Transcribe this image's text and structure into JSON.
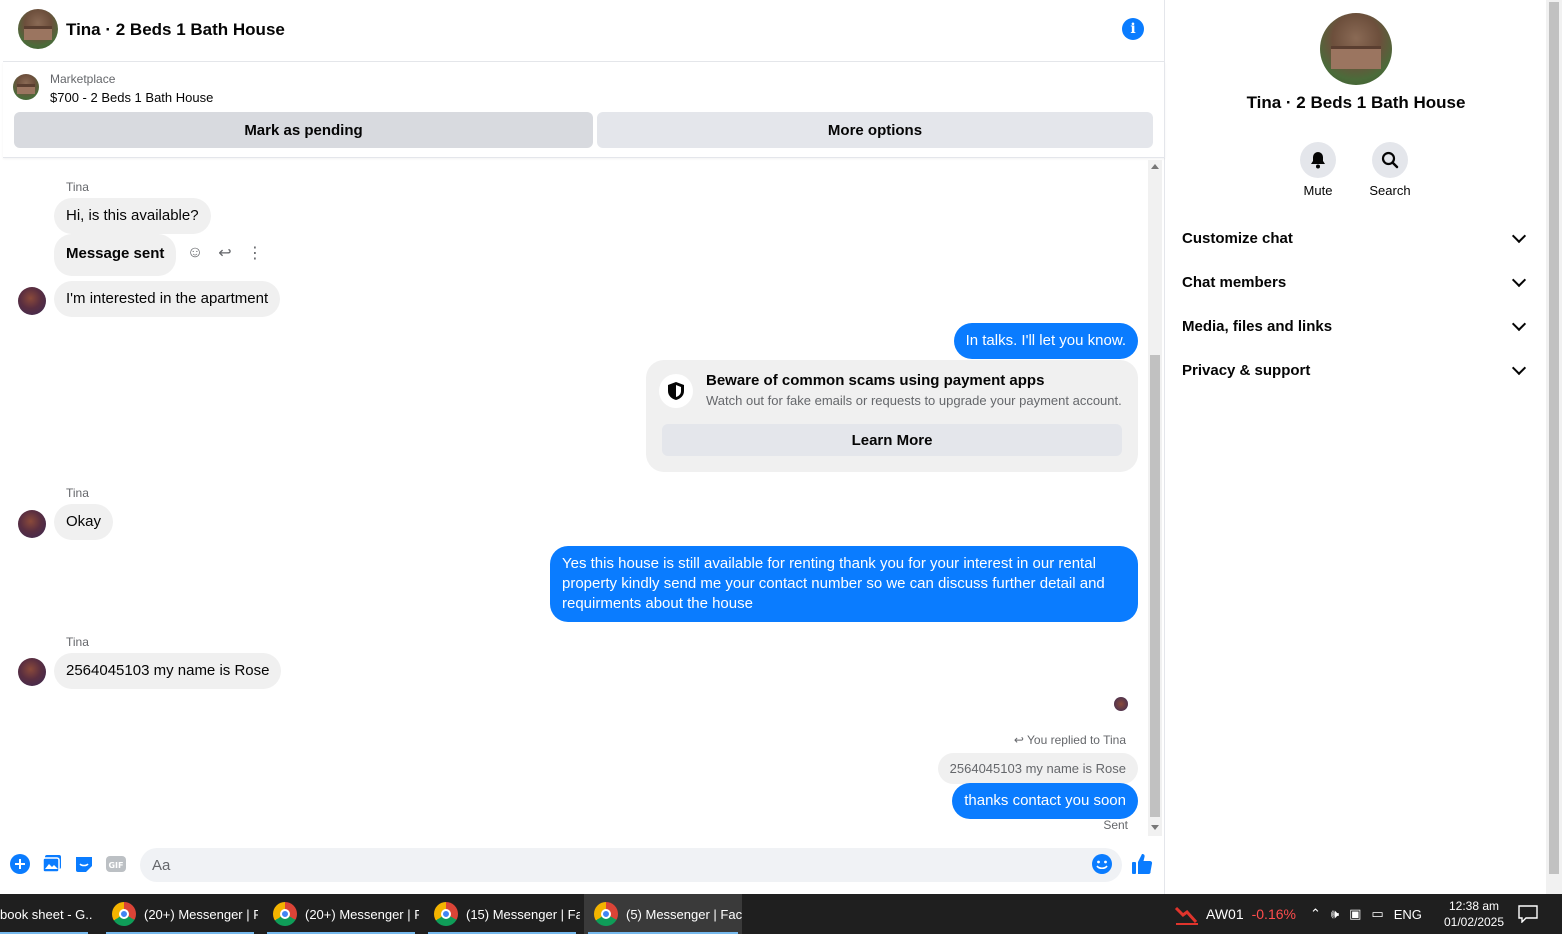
{
  "header": {
    "title": "Tina · 2 Beds 1 Bath House",
    "info_icon": "info-icon"
  },
  "listing": {
    "source": "Marketplace",
    "price_title": "$700 - 2 Beds 1 Bath House",
    "mark_pending": "Mark as pending",
    "more_options": "More options"
  },
  "messages": {
    "sender1": "Tina",
    "m1": "Hi, is this available?",
    "m2": "Message sent",
    "m3": "I'm interested in the apartment",
    "m4": "In talks. I'll let you know.",
    "scam_title": "Beware of common scams using payment apps",
    "scam_body": "Watch out for fake emails or requests to upgrade your payment account.",
    "scam_button": "Learn More",
    "sender2": "Tina",
    "m5": "Okay",
    "m6": "Yes this house is still available for renting thank you for your interest in our rental property kindly send me your contact number so we can discuss further detail and requirments about the house",
    "sender3": "Tina",
    "m7": "2564045103 my name is Rose",
    "reply_note": "You replied to Tina",
    "quoted": "2564045103 my name is Rose",
    "m8": "thanks contact you soon",
    "sent": "Sent"
  },
  "composer": {
    "placeholder": "Aa"
  },
  "right_panel": {
    "name": "Tina · 2 Beds 1 Bath House",
    "mute": "Mute",
    "search": "Search",
    "sections": [
      "Customize chat",
      "Chat members",
      "Media, files and links",
      "Privacy & support"
    ]
  },
  "taskbar": {
    "tasks": [
      "book sheet - G...",
      "(20+) Messenger | F...",
      "(20+) Messenger | F...",
      "(15) Messenger | Fa...",
      "(5) Messenger | Fac..."
    ],
    "ticker": "AW01",
    "change": "-0.16%",
    "lang": "ENG",
    "time": "12:38 am",
    "date": "01/02/2025"
  },
  "colors": {
    "accent": "#0a7cff",
    "negative": "#ff4d4d"
  }
}
